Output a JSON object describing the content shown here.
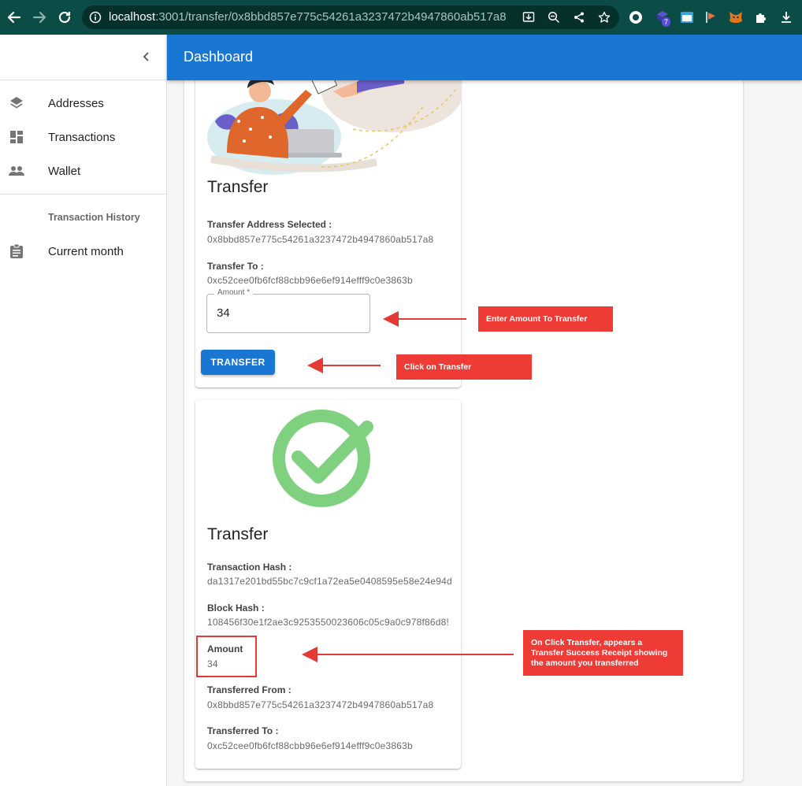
{
  "browser": {
    "url_host": "localhost",
    "url_path": ":3001/transfer/0x8bbd857e775c54261a3237472b4947860ab517a8",
    "extension_badge": "7"
  },
  "sidebar": {
    "items": [
      {
        "label": "Addresses",
        "icon": "layers-icon"
      },
      {
        "label": "Transactions",
        "icon": "dashboard-icon"
      },
      {
        "label": "Wallet",
        "icon": "people-icon"
      }
    ],
    "section_header": "Transaction History",
    "history_items": [
      {
        "label": "Current month",
        "icon": "assignment-icon"
      }
    ]
  },
  "appbar": {
    "title": "Dashboard"
  },
  "transfer_form": {
    "title": "Transfer",
    "address_label": "Transfer Address Selected :",
    "address_value": "0x8bbd857e775c54261a3237472b4947860ab517a8",
    "to_label": "Transfer To :",
    "to_value": "0xc52cee0fb6fcf88cbb96e6ef914efff9c0e3863b",
    "amount_label": "Amount *",
    "amount_value": "34",
    "button_label": "TRANSFER"
  },
  "receipt": {
    "title": "Transfer",
    "tx_hash_label": "Transaction Hash :",
    "tx_hash_value": "da1317e201bd55bc7c9cf1a72ea5e0408595e58e24e94d",
    "block_hash_label": "Block Hash :",
    "block_hash_value": "108456f30e1f2ae3c9253550023606c05c9a0c978f86d8!",
    "amount_label": "Amount",
    "amount_value": "34",
    "from_label": "Transferred From :",
    "from_value": "0x8bbd857e775c54261a3237472b4947860ab517a8",
    "to_label": "Transferred To :",
    "to_value": "0xc52cee0fb6fcf88cbb96e6ef914efff9c0e3863b"
  },
  "annotations": {
    "enter_amount": "Enter Amount To Transfer",
    "click_transfer": "Click on Transfer",
    "receipt_note": "On Click Transfer, appears a Transfer Success Receipt showing the amount you transferred"
  },
  "colors": {
    "chrome": "#0b4c46",
    "appbar": "#1976d2",
    "button": "#1976d2",
    "success_check": "#7fd17f",
    "annotation": "#ef3b36"
  }
}
